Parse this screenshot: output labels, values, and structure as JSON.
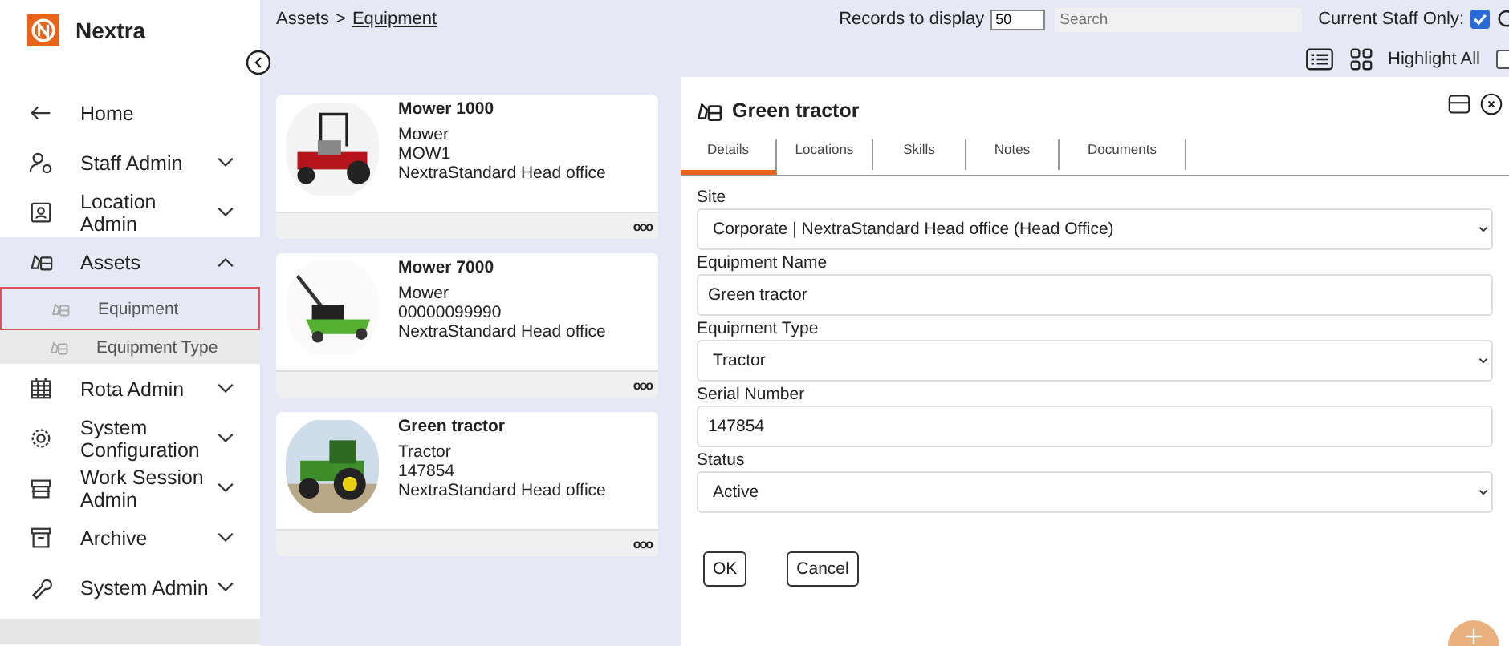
{
  "app": {
    "name": "Nextra"
  },
  "sidebar": {
    "items": [
      {
        "label": "Home",
        "kind": "link"
      },
      {
        "label": "Staff Admin",
        "kind": "group",
        "expanded": false,
        "selected": false
      },
      {
        "label": "Location Admin",
        "kind": "group",
        "expanded": false,
        "selected": false
      },
      {
        "label": "Assets",
        "kind": "group",
        "expanded": true,
        "selected": true,
        "children": [
          {
            "label": "Equipment",
            "selected": true
          },
          {
            "label": "Equipment Type",
            "selected": false
          }
        ]
      },
      {
        "label": "Rota Admin",
        "kind": "group",
        "expanded": false,
        "selected": false
      },
      {
        "label": "System Configuration",
        "kind": "group",
        "expanded": false,
        "selected": false
      },
      {
        "label": "Work Session Admin",
        "kind": "group",
        "expanded": false,
        "selected": false
      },
      {
        "label": "Archive",
        "kind": "group",
        "expanded": false,
        "selected": false
      },
      {
        "label": "System Admin",
        "kind": "group",
        "expanded": false,
        "selected": false
      }
    ]
  },
  "breadcrumb": {
    "parent": "Assets",
    "separator": ">",
    "current": "Equipment"
  },
  "toolbar": {
    "records_label": "Records to display",
    "records_value": "50",
    "search": {
      "placeholder": "Search"
    },
    "current_staff_label": "Current Staff Only:",
    "current_staff_checked": true,
    "highlight_label": "Highlight All",
    "highlight_checked": false
  },
  "cards": [
    {
      "title": "Mower 1000",
      "type": "Mower",
      "serial": "MOW1",
      "location": "NextraStandard Head office",
      "more": "ooo"
    },
    {
      "title": "Mower 7000",
      "type": "Mower",
      "serial": "00000099990",
      "location": "NextraStandard Head office",
      "more": "ooo"
    },
    {
      "title": "Green tractor",
      "type": "Tractor",
      "serial": "147854",
      "location": "NextraStandard Head office",
      "more": "ooo"
    }
  ],
  "detail": {
    "title": "Green tractor",
    "tabs": [
      {
        "label": "Details",
        "selected": true
      },
      {
        "label": "Locations",
        "selected": false
      },
      {
        "label": "Skills",
        "selected": false
      },
      {
        "label": "Notes",
        "selected": false
      },
      {
        "label": "Documents",
        "selected": false
      }
    ],
    "fields": [
      {
        "label": "Site",
        "kind": "select",
        "value": "Corporate | NextraStandard Head office (Head Office)"
      },
      {
        "label": "Equipment Name",
        "kind": "text",
        "value": "Green tractor"
      },
      {
        "label": "Equipment Type",
        "kind": "select",
        "value": "Tractor"
      },
      {
        "label": "Serial Number",
        "kind": "text",
        "value": "147854"
      },
      {
        "label": "Status",
        "kind": "select",
        "value": "Active"
      }
    ],
    "buttons": [
      "OK",
      "Cancel"
    ]
  }
}
